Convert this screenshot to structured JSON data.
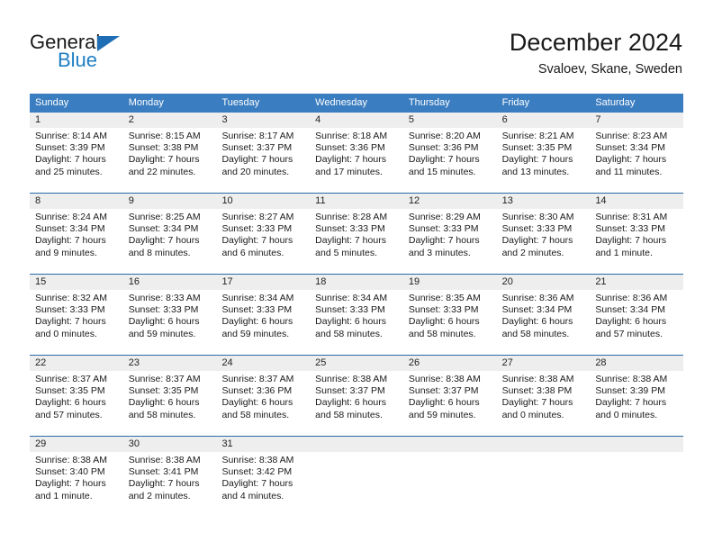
{
  "brand": {
    "name_top": "General",
    "name_bottom": "Blue",
    "triangle_color": "#1f6db5",
    "blue_color": "#1f7ec4"
  },
  "header": {
    "title": "December 2024",
    "subtitle": "Svaloev, Skane, Sweden"
  },
  "calendar": {
    "header_bg": "#3a7dc0",
    "daynum_bg": "#eeeeee",
    "weekdays": [
      "Sunday",
      "Monday",
      "Tuesday",
      "Wednesday",
      "Thursday",
      "Friday",
      "Saturday"
    ],
    "weeks": [
      [
        {
          "day": "1",
          "sunrise": "Sunrise: 8:14 AM",
          "sunset": "Sunset: 3:39 PM",
          "daylight_1": "Daylight: 7 hours",
          "daylight_2": "and 25 minutes."
        },
        {
          "day": "2",
          "sunrise": "Sunrise: 8:15 AM",
          "sunset": "Sunset: 3:38 PM",
          "daylight_1": "Daylight: 7 hours",
          "daylight_2": "and 22 minutes."
        },
        {
          "day": "3",
          "sunrise": "Sunrise: 8:17 AM",
          "sunset": "Sunset: 3:37 PM",
          "daylight_1": "Daylight: 7 hours",
          "daylight_2": "and 20 minutes."
        },
        {
          "day": "4",
          "sunrise": "Sunrise: 8:18 AM",
          "sunset": "Sunset: 3:36 PM",
          "daylight_1": "Daylight: 7 hours",
          "daylight_2": "and 17 minutes."
        },
        {
          "day": "5",
          "sunrise": "Sunrise: 8:20 AM",
          "sunset": "Sunset: 3:36 PM",
          "daylight_1": "Daylight: 7 hours",
          "daylight_2": "and 15 minutes."
        },
        {
          "day": "6",
          "sunrise": "Sunrise: 8:21 AM",
          "sunset": "Sunset: 3:35 PM",
          "daylight_1": "Daylight: 7 hours",
          "daylight_2": "and 13 minutes."
        },
        {
          "day": "7",
          "sunrise": "Sunrise: 8:23 AM",
          "sunset": "Sunset: 3:34 PM",
          "daylight_1": "Daylight: 7 hours",
          "daylight_2": "and 11 minutes."
        }
      ],
      [
        {
          "day": "8",
          "sunrise": "Sunrise: 8:24 AM",
          "sunset": "Sunset: 3:34 PM",
          "daylight_1": "Daylight: 7 hours",
          "daylight_2": "and 9 minutes."
        },
        {
          "day": "9",
          "sunrise": "Sunrise: 8:25 AM",
          "sunset": "Sunset: 3:34 PM",
          "daylight_1": "Daylight: 7 hours",
          "daylight_2": "and 8 minutes."
        },
        {
          "day": "10",
          "sunrise": "Sunrise: 8:27 AM",
          "sunset": "Sunset: 3:33 PM",
          "daylight_1": "Daylight: 7 hours",
          "daylight_2": "and 6 minutes."
        },
        {
          "day": "11",
          "sunrise": "Sunrise: 8:28 AM",
          "sunset": "Sunset: 3:33 PM",
          "daylight_1": "Daylight: 7 hours",
          "daylight_2": "and 5 minutes."
        },
        {
          "day": "12",
          "sunrise": "Sunrise: 8:29 AM",
          "sunset": "Sunset: 3:33 PM",
          "daylight_1": "Daylight: 7 hours",
          "daylight_2": "and 3 minutes."
        },
        {
          "day": "13",
          "sunrise": "Sunrise: 8:30 AM",
          "sunset": "Sunset: 3:33 PM",
          "daylight_1": "Daylight: 7 hours",
          "daylight_2": "and 2 minutes."
        },
        {
          "day": "14",
          "sunrise": "Sunrise: 8:31 AM",
          "sunset": "Sunset: 3:33 PM",
          "daylight_1": "Daylight: 7 hours",
          "daylight_2": "and 1 minute."
        }
      ],
      [
        {
          "day": "15",
          "sunrise": "Sunrise: 8:32 AM",
          "sunset": "Sunset: 3:33 PM",
          "daylight_1": "Daylight: 7 hours",
          "daylight_2": "and 0 minutes."
        },
        {
          "day": "16",
          "sunrise": "Sunrise: 8:33 AM",
          "sunset": "Sunset: 3:33 PM",
          "daylight_1": "Daylight: 6 hours",
          "daylight_2": "and 59 minutes."
        },
        {
          "day": "17",
          "sunrise": "Sunrise: 8:34 AM",
          "sunset": "Sunset: 3:33 PM",
          "daylight_1": "Daylight: 6 hours",
          "daylight_2": "and 59 minutes."
        },
        {
          "day": "18",
          "sunrise": "Sunrise: 8:34 AM",
          "sunset": "Sunset: 3:33 PM",
          "daylight_1": "Daylight: 6 hours",
          "daylight_2": "and 58 minutes."
        },
        {
          "day": "19",
          "sunrise": "Sunrise: 8:35 AM",
          "sunset": "Sunset: 3:33 PM",
          "daylight_1": "Daylight: 6 hours",
          "daylight_2": "and 58 minutes."
        },
        {
          "day": "20",
          "sunrise": "Sunrise: 8:36 AM",
          "sunset": "Sunset: 3:34 PM",
          "daylight_1": "Daylight: 6 hours",
          "daylight_2": "and 58 minutes."
        },
        {
          "day": "21",
          "sunrise": "Sunrise: 8:36 AM",
          "sunset": "Sunset: 3:34 PM",
          "daylight_1": "Daylight: 6 hours",
          "daylight_2": "and 57 minutes."
        }
      ],
      [
        {
          "day": "22",
          "sunrise": "Sunrise: 8:37 AM",
          "sunset": "Sunset: 3:35 PM",
          "daylight_1": "Daylight: 6 hours",
          "daylight_2": "and 57 minutes."
        },
        {
          "day": "23",
          "sunrise": "Sunrise: 8:37 AM",
          "sunset": "Sunset: 3:35 PM",
          "daylight_1": "Daylight: 6 hours",
          "daylight_2": "and 58 minutes."
        },
        {
          "day": "24",
          "sunrise": "Sunrise: 8:37 AM",
          "sunset": "Sunset: 3:36 PM",
          "daylight_1": "Daylight: 6 hours",
          "daylight_2": "and 58 minutes."
        },
        {
          "day": "25",
          "sunrise": "Sunrise: 8:38 AM",
          "sunset": "Sunset: 3:37 PM",
          "daylight_1": "Daylight: 6 hours",
          "daylight_2": "and 58 minutes."
        },
        {
          "day": "26",
          "sunrise": "Sunrise: 8:38 AM",
          "sunset": "Sunset: 3:37 PM",
          "daylight_1": "Daylight: 6 hours",
          "daylight_2": "and 59 minutes."
        },
        {
          "day": "27",
          "sunrise": "Sunrise: 8:38 AM",
          "sunset": "Sunset: 3:38 PM",
          "daylight_1": "Daylight: 7 hours",
          "daylight_2": "and 0 minutes."
        },
        {
          "day": "28",
          "sunrise": "Sunrise: 8:38 AM",
          "sunset": "Sunset: 3:39 PM",
          "daylight_1": "Daylight: 7 hours",
          "daylight_2": "and 0 minutes."
        }
      ],
      [
        {
          "day": "29",
          "sunrise": "Sunrise: 8:38 AM",
          "sunset": "Sunset: 3:40 PM",
          "daylight_1": "Daylight: 7 hours",
          "daylight_2": "and 1 minute."
        },
        {
          "day": "30",
          "sunrise": "Sunrise: 8:38 AM",
          "sunset": "Sunset: 3:41 PM",
          "daylight_1": "Daylight: 7 hours",
          "daylight_2": "and 2 minutes."
        },
        {
          "day": "31",
          "sunrise": "Sunrise: 8:38 AM",
          "sunset": "Sunset: 3:42 PM",
          "daylight_1": "Daylight: 7 hours",
          "daylight_2": "and 4 minutes."
        },
        {
          "day": "",
          "sunrise": "",
          "sunset": "",
          "daylight_1": "",
          "daylight_2": ""
        },
        {
          "day": "",
          "sunrise": "",
          "sunset": "",
          "daylight_1": "",
          "daylight_2": ""
        },
        {
          "day": "",
          "sunrise": "",
          "sunset": "",
          "daylight_1": "",
          "daylight_2": ""
        },
        {
          "day": "",
          "sunrise": "",
          "sunset": "",
          "daylight_1": "",
          "daylight_2": ""
        }
      ]
    ]
  }
}
